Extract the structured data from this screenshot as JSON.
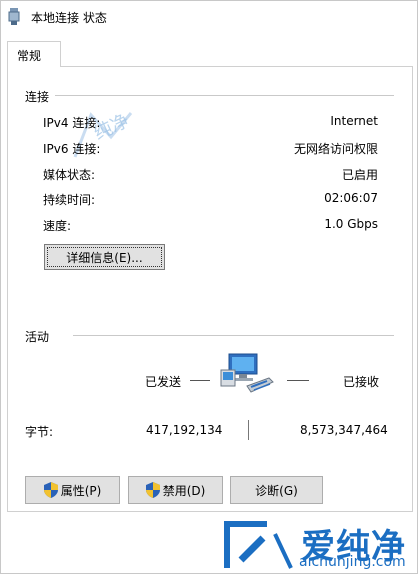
{
  "window": {
    "title": "本地连接 状态"
  },
  "tabs": [
    {
      "label": "常规"
    }
  ],
  "connection": {
    "group_title": "连接",
    "rows": [
      {
        "label": "IPv4 连接:",
        "value": "Internet"
      },
      {
        "label": "IPv6 连接:",
        "value": "无网络访问权限"
      },
      {
        "label": "媒体状态:",
        "value": "已启用"
      },
      {
        "label": "持续时间:",
        "value": "02:06:07"
      },
      {
        "label": "速度:",
        "value": "1.0 Gbps"
      }
    ],
    "details_button": "详细信息(E)..."
  },
  "activity": {
    "group_title": "活动",
    "sent_label": "已发送",
    "received_label": "已接收",
    "bytes_label": "字节:",
    "bytes_sent": "417,192,134",
    "bytes_received": "8,573,347,464"
  },
  "buttons": {
    "properties": "属性(P)",
    "disable": "禁用(D)",
    "diagnose": "诊断(G)"
  },
  "watermark": {
    "brand": "爱纯净",
    "url": "aichunjing.com",
    "faint_text": "纯净"
  },
  "colors": {
    "accent": "#1b6ec2",
    "button_bg": "#e1e1e1",
    "divider": "#c9c9c9"
  },
  "icons": {
    "title": "network-adapter-icon",
    "activity": "network-computers-icon",
    "uac": "uac-shield-icon"
  }
}
